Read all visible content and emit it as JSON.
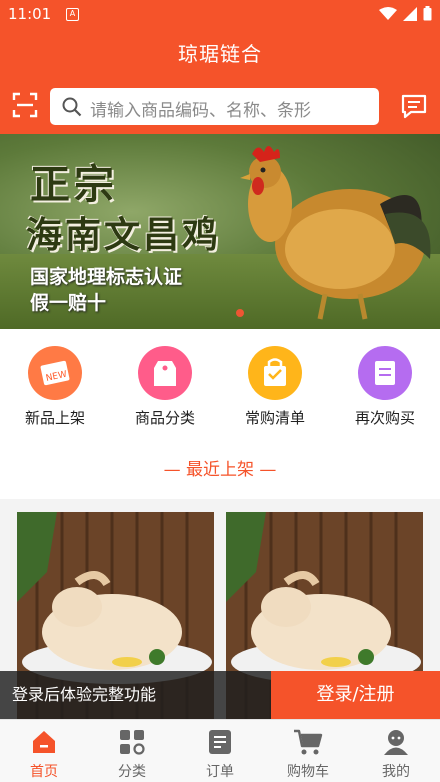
{
  "status": {
    "time": "11:01",
    "notif": "A"
  },
  "app": {
    "title": "琼琚链合"
  },
  "search": {
    "placeholder": "请输入商品编码、名称、条形"
  },
  "banner": {
    "line1": "正宗",
    "line2": "海南文昌鸡",
    "line3": "国家地理标志认证",
    "line4": "假一赔十"
  },
  "quick": [
    {
      "label": "新品上架",
      "icon": "new-tag-icon",
      "color": "#ff7a45"
    },
    {
      "label": "商品分类",
      "icon": "tag-icon",
      "color": "#ff5c8a"
    },
    {
      "label": "常购清单",
      "icon": "bag-icon",
      "color": "#ffb51a"
    },
    {
      "label": "再次购买",
      "icon": "list-icon",
      "color": "#b56cf0"
    }
  ],
  "section": {
    "title": "— 最近上架 —"
  },
  "login": {
    "tip": "登录后体验完整功能",
    "button": "登录/注册"
  },
  "tabs": [
    {
      "label": "首页",
      "icon": "home-icon",
      "active": true
    },
    {
      "label": "分类",
      "icon": "category-icon",
      "active": false
    },
    {
      "label": "订单",
      "icon": "order-icon",
      "active": false
    },
    {
      "label": "购物车",
      "icon": "cart-icon",
      "active": false
    },
    {
      "label": "我的",
      "icon": "profile-icon",
      "active": false
    }
  ],
  "colors": {
    "brand": "#f5532a",
    "tab_inactive": "#666666"
  }
}
